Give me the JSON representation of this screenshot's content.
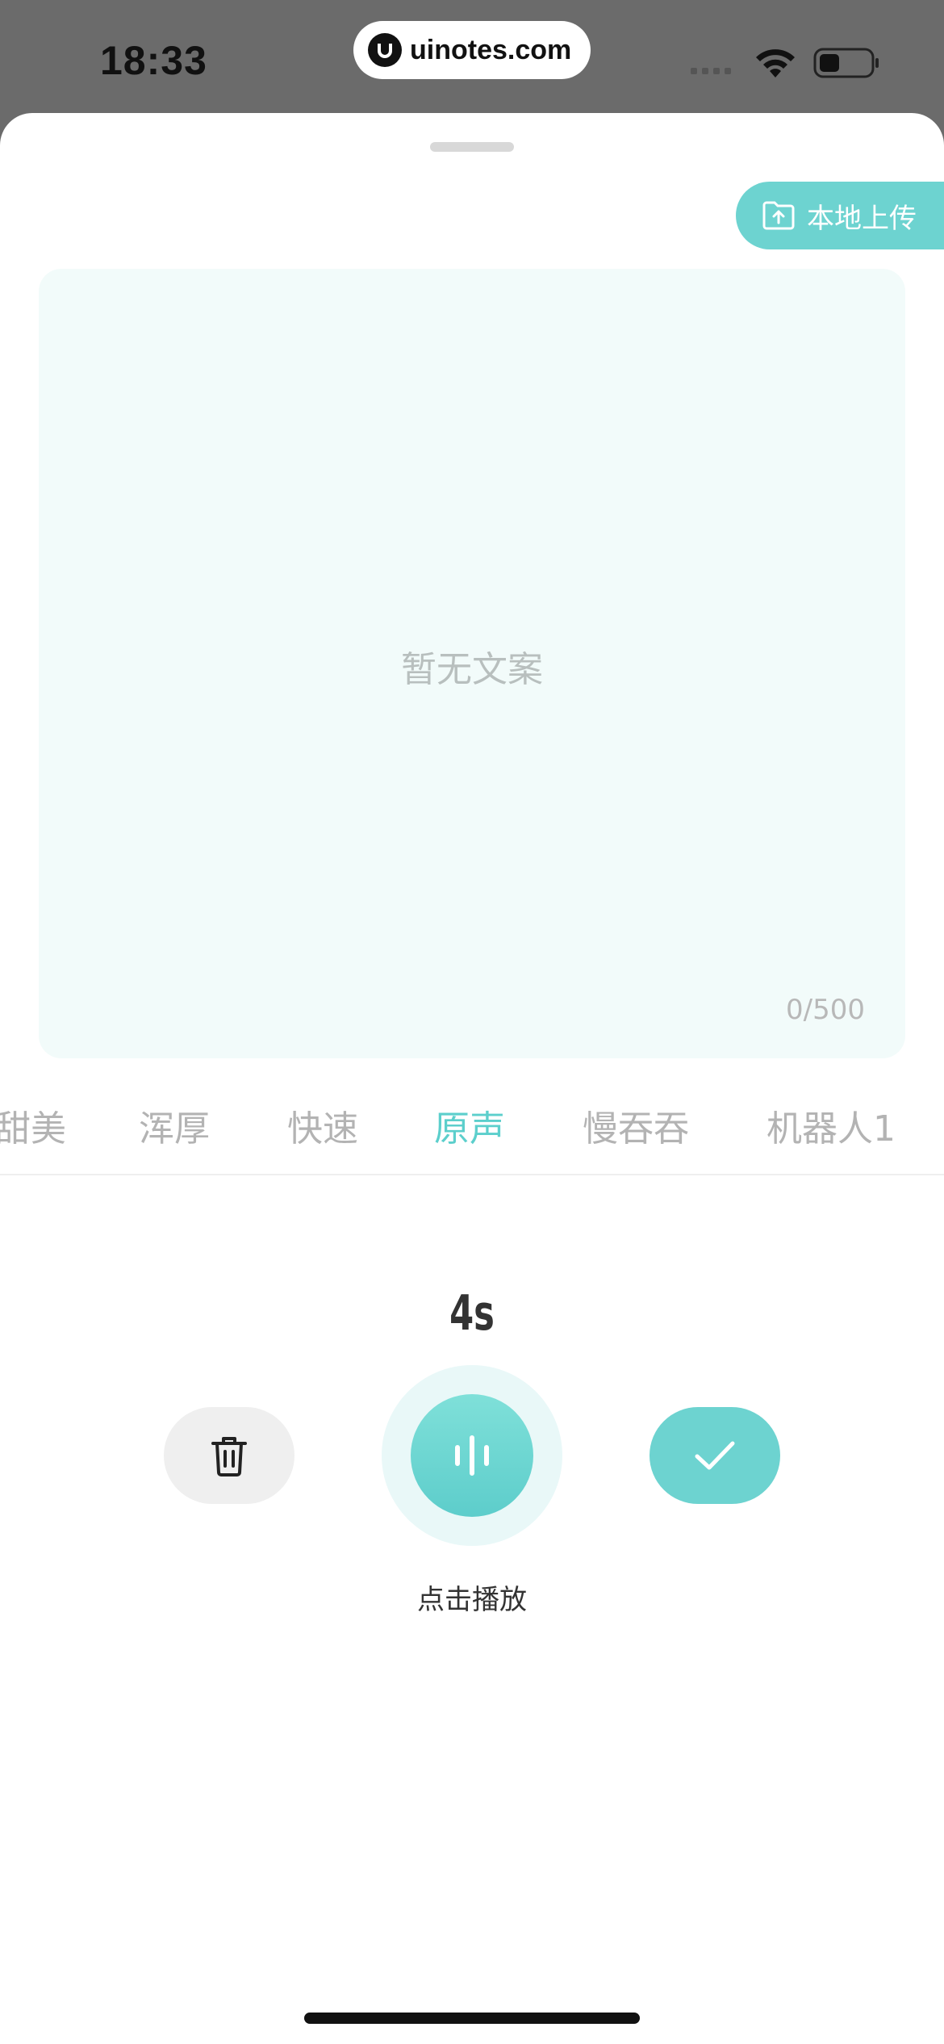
{
  "status_bar": {
    "time": "18:33",
    "url": "uinotes.com",
    "icons": [
      "signal-icon",
      "wifi-icon",
      "battery-icon"
    ]
  },
  "upload": {
    "label": "本地上传",
    "icon": "upload-folder-icon"
  },
  "editor": {
    "placeholder": "暂无文案",
    "counter": "0/500"
  },
  "voices": {
    "items": [
      "甜美",
      "浑厚",
      "快速",
      "原声",
      "慢吞吞",
      "机器人1"
    ],
    "selected": "原声"
  },
  "recorder": {
    "duration": "4s",
    "play_label": "点击播放",
    "delete_icon": "trash-icon",
    "play_icon": "sound-wave-icon",
    "confirm_icon": "check-icon"
  },
  "colors": {
    "accent": "#6dd3d0",
    "editor_bg": "#f2fbfa",
    "inactive_text": "#b3b3b3"
  }
}
